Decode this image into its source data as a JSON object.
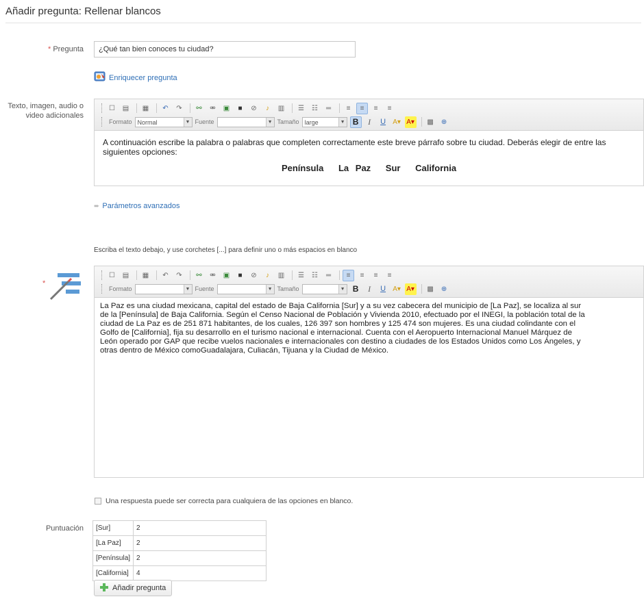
{
  "page": {
    "title": "Añadir pregunta: Rellenar blancos"
  },
  "question": {
    "label": "Pregunta",
    "required_mark": "*",
    "value": "¿Qué tan bien conoces tu ciudad?",
    "enrich_link": "Enriquecer pregunta"
  },
  "extra": {
    "label_line1": "Texto, imagen, audio o",
    "label_line2": "video adicionales",
    "toolbar": {
      "format_label": "Formato",
      "format_value": "Normal",
      "font_label": "Fuente",
      "font_value": "",
      "size_label": "Tamaño",
      "size_value": "large"
    },
    "content_text": "A continuación escribe la palabra o palabras que completen correctamente este breve párrafo sobre tu ciudad. Deberás elegir de entre las siguientes opciones:",
    "options": [
      "Península",
      "La Paz",
      "Sur",
      "California"
    ]
  },
  "advanced_link": "Parámetros avanzados",
  "instructions": "Escriba el texto debajo, y use corchetes [...] para definir uno o más espacios en blanco",
  "blanks_editor": {
    "required_mark": "*",
    "toolbar": {
      "format_label": "Formato",
      "format_value": "",
      "font_label": "Fuente",
      "font_value": "",
      "size_label": "Tamaño",
      "size_value": ""
    },
    "lines": [
      "La Paz es una ciudad mexicana, capital del estado de Baja California [Sur] y a su vez cabecera del municipio de [La Paz], se localiza al sur",
      "de la [Península] de Baja California. Según el Censo Nacional de Población y Vivienda 2010, efectuado por el INEGI, la población total de la",
      "ciudad de La Paz es de 251 871 habitantes, de los cuales, 126 397 son hombres y 125 474 son mujeres. Es una ciudad colindante con el",
      "Golfo de [California], fija su desarrollo en el turismo nacional e internacional. Cuenta con el Aeropuerto Internacional Manuel Márquez de",
      "León operado por GAP que recibe vuelos nacionales e internacionales con destino a ciudades de los Estados Unidos como Los Ángeles, y",
      "otras dentro de México comoGuadalajara, Culiacán, Tijuana y la Ciudad de México."
    ]
  },
  "any_answer_checkbox": "Una respuesta puede ser correcta para cualquiera de las opciones en blanco.",
  "scoring": {
    "label": "Puntuación",
    "rows": [
      {
        "key": "[Sur]",
        "value": "2"
      },
      {
        "key": "[La Paz]",
        "value": "2"
      },
      {
        "key": "[Península]",
        "value": "2"
      },
      {
        "key": "[California]",
        "value": "4"
      }
    ]
  },
  "add_button": "Añadir pregunta",
  "colors": {
    "link": "#2f6fb6",
    "required": "#d9534f",
    "add_icon": "#5cb85c"
  }
}
